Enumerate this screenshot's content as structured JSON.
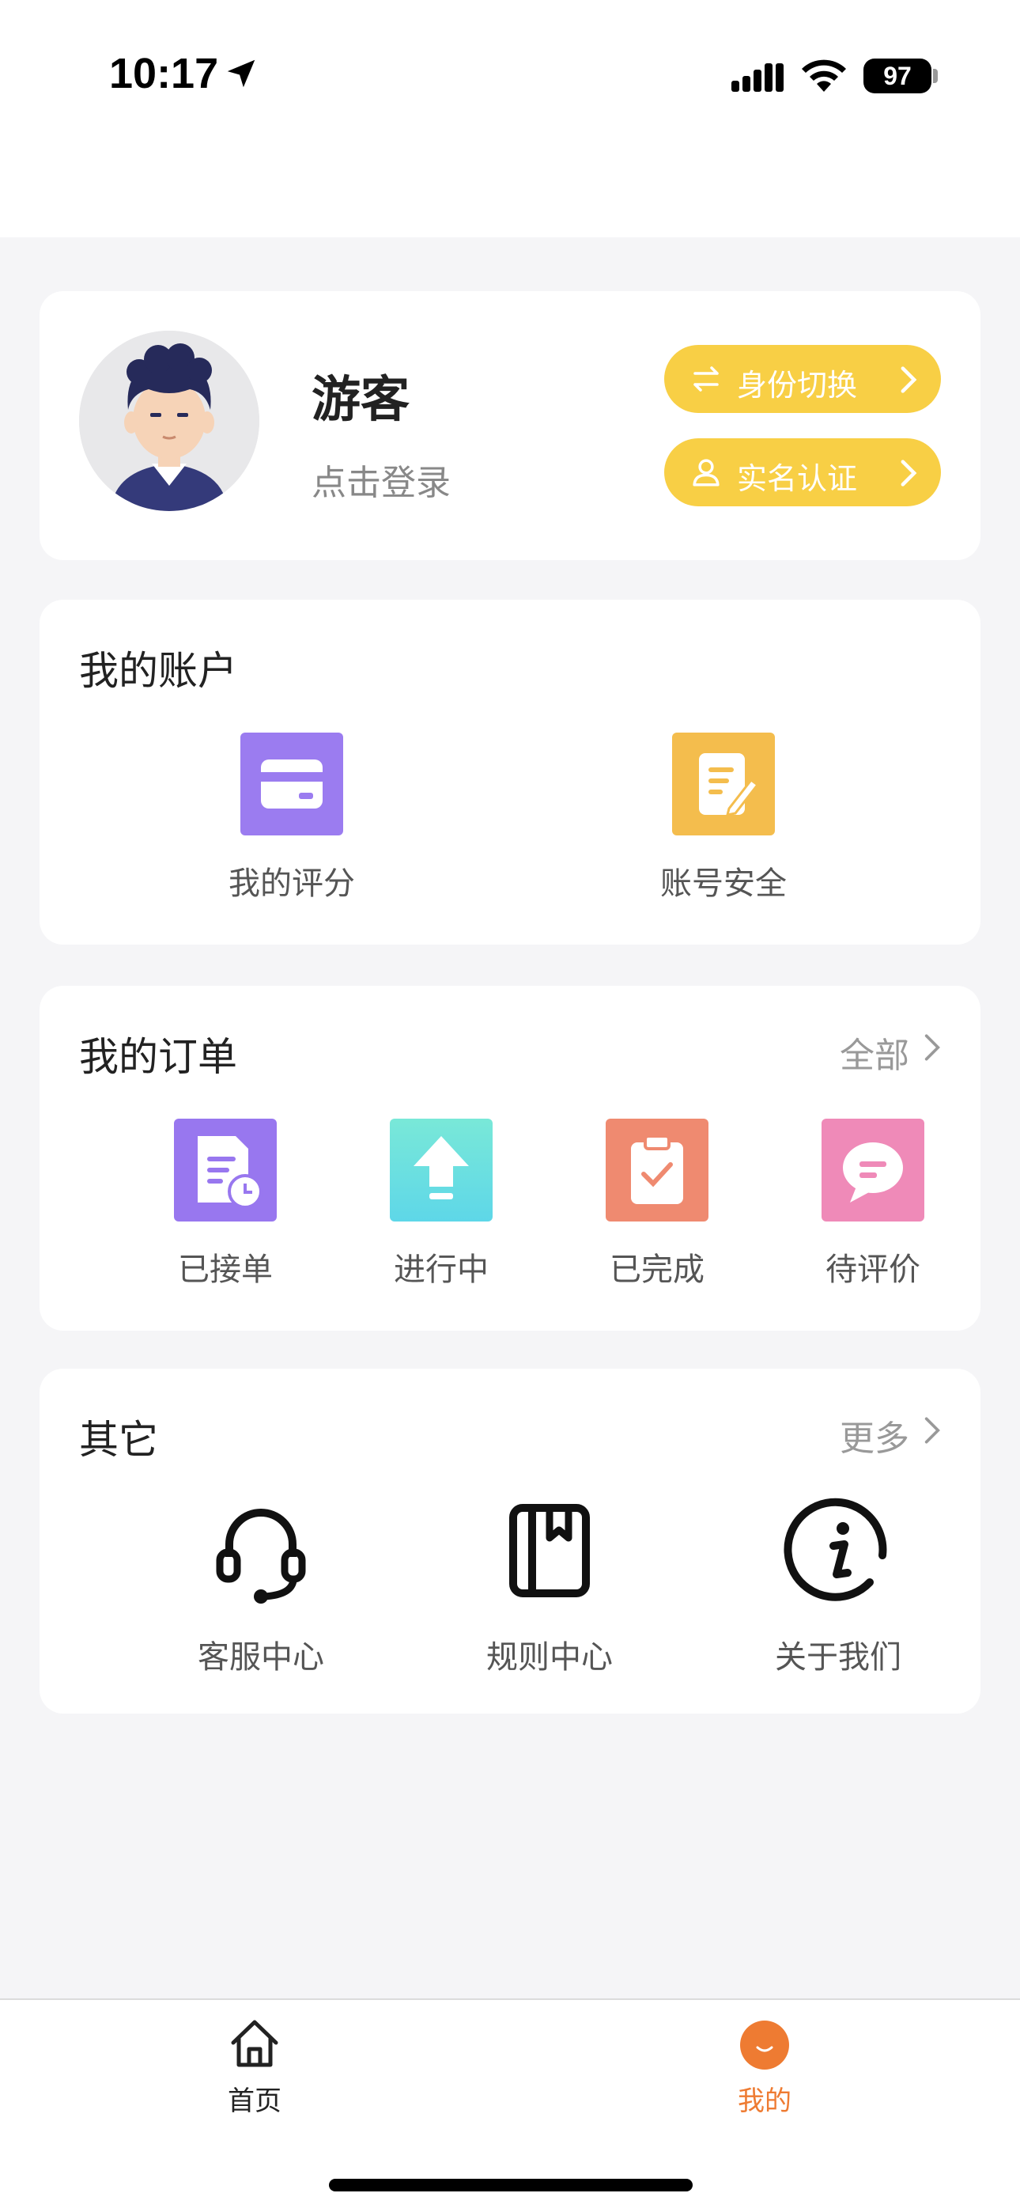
{
  "status_bar": {
    "time": "10:17",
    "battery": "97"
  },
  "profile": {
    "name": "游客",
    "login_hint": "点击登录",
    "switch_label": "身份切换",
    "verify_label": "实名认证"
  },
  "account": {
    "title": "我的账户",
    "items": [
      {
        "label": "我的评分",
        "icon": "card-icon",
        "color": "#9b7cf0"
      },
      {
        "label": "账号安全",
        "icon": "note-edit-icon",
        "color": "#f4bd4d"
      }
    ]
  },
  "orders": {
    "title": "我的订单",
    "more": "全部",
    "items": [
      {
        "label": "已接单",
        "icon": "doc-clock-icon",
        "color": "#9877ef"
      },
      {
        "label": "进行中",
        "icon": "upload-arrow-icon",
        "color": "#6fe2d7"
      },
      {
        "label": "已完成",
        "icon": "clipboard-check-icon",
        "color": "#ef8a70"
      },
      {
        "label": "待评价",
        "icon": "chat-bubble-icon",
        "color": "#ef8ab8"
      }
    ]
  },
  "other": {
    "title": "其它",
    "more": "更多",
    "items": [
      {
        "label": "客服中心",
        "icon": "headset-icon"
      },
      {
        "label": "规则中心",
        "icon": "book-icon"
      },
      {
        "label": "关于我们",
        "icon": "info-icon"
      }
    ]
  },
  "tabbar": {
    "home": {
      "label": "首页",
      "color": "#222222"
    },
    "mine": {
      "label": "我的",
      "color": "#ee7b32"
    }
  }
}
